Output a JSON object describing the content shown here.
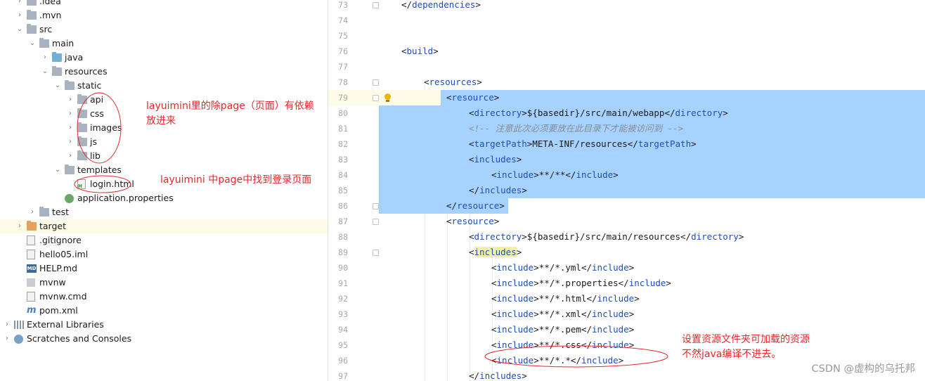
{
  "tree": [
    {
      "label": ".idea",
      "icon": "folder-icon",
      "depth": 1,
      "arrow": "›"
    },
    {
      "label": ".mvn",
      "icon": "folder-icon",
      "depth": 1,
      "arrow": "›"
    },
    {
      "label": "src",
      "icon": "folder-icon",
      "depth": 1,
      "arrow": "⌄"
    },
    {
      "label": "main",
      "icon": "folder-icon",
      "depth": 2,
      "arrow": "⌄"
    },
    {
      "label": "java",
      "icon": "folder-blue-icon",
      "depth": 3,
      "arrow": "›"
    },
    {
      "label": "resources",
      "icon": "folder-resources-icon",
      "depth": 3,
      "arrow": "⌄"
    },
    {
      "label": "static",
      "icon": "folder-icon",
      "depth": 4,
      "arrow": "⌄"
    },
    {
      "label": "api",
      "icon": "folder-icon",
      "depth": 5,
      "arrow": "›"
    },
    {
      "label": "css",
      "icon": "folder-icon",
      "depth": 5,
      "arrow": "›"
    },
    {
      "label": "images",
      "icon": "folder-icon",
      "depth": 5,
      "arrow": "›"
    },
    {
      "label": "js",
      "icon": "folder-icon",
      "depth": 5,
      "arrow": "›"
    },
    {
      "label": "lib",
      "icon": "folder-icon",
      "depth": 5,
      "arrow": "›"
    },
    {
      "label": "templates",
      "icon": "folder-icon",
      "depth": 4,
      "arrow": "⌄"
    },
    {
      "label": "login.html",
      "icon": "html-file-icon",
      "depth": 5,
      "arrow": ""
    },
    {
      "label": "application.properties",
      "icon": "properties-file-icon",
      "depth": 4,
      "arrow": ""
    },
    {
      "label": "test",
      "icon": "folder-icon",
      "depth": 2,
      "arrow": "›"
    },
    {
      "label": "target",
      "icon": "folder-orange-icon",
      "depth": 1,
      "arrow": "›",
      "selected": true
    },
    {
      "label": ".gitignore",
      "icon": "file-icon",
      "depth": 1,
      "arrow": ""
    },
    {
      "label": "hello05.iml",
      "icon": "iml-file-icon",
      "depth": 1,
      "arrow": ""
    },
    {
      "label": "HELP.md",
      "icon": "md-file-icon",
      "depth": 1,
      "arrow": ""
    },
    {
      "label": "mvnw",
      "icon": "mvnw-file-icon",
      "depth": 1,
      "arrow": ""
    },
    {
      "label": "mvnw.cmd",
      "icon": "file-icon",
      "depth": 1,
      "arrow": ""
    },
    {
      "label": "pom.xml",
      "icon": "maven-icon",
      "depth": 1,
      "arrow": ""
    },
    {
      "label": "External Libraries",
      "icon": "libraries-icon",
      "depth": 0,
      "arrow": "›"
    },
    {
      "label": "Scratches and Consoles",
      "icon": "scratches-icon",
      "depth": 0,
      "arrow": "›"
    }
  ],
  "annotations": {
    "static_note_line1": "layuimini里的除page（页面）有依赖",
    "static_note_line2": "放进来",
    "templates_note": "layuimini 中page中找到登录页面",
    "editor_note_line1": "设置资源文件夹可加载的资源",
    "editor_note_line2": "不然java编译不进去。",
    "color": "#e8282d"
  },
  "editor": {
    "lines": [
      {
        "num": "73",
        "indent": 0,
        "tokens": [
          [
            "t",
            "</"
          ],
          [
            "n",
            "dependencies"
          ],
          [
            "t",
            ">"
          ]
        ]
      },
      {
        "num": "74",
        "indent": 0,
        "tokens": []
      },
      {
        "num": "75",
        "indent": 0,
        "tokens": []
      },
      {
        "num": "76",
        "indent": 0,
        "tokens": [
          [
            "t",
            "<"
          ],
          [
            "n",
            "build"
          ],
          [
            "t",
            ">"
          ]
        ]
      },
      {
        "num": "77",
        "indent": 0,
        "tokens": []
      },
      {
        "num": "78",
        "indent": 1,
        "tokens": [
          [
            "t",
            "<"
          ],
          [
            "n",
            "resources"
          ],
          [
            "t",
            ">"
          ]
        ]
      },
      {
        "num": "79",
        "indent": 2,
        "tokens": [
          [
            "t",
            "<"
          ],
          [
            "n",
            "resource"
          ],
          [
            "t",
            ">"
          ]
        ],
        "caret": true,
        "bulb": true
      },
      {
        "num": "80",
        "indent": 3,
        "tokens": [
          [
            "t",
            "<"
          ],
          [
            "n",
            "directory"
          ],
          [
            "t",
            ">${basedir}/src/main/webapp</"
          ],
          [
            "n",
            "directory"
          ],
          [
            "t",
            ">"
          ]
        ]
      },
      {
        "num": "81",
        "indent": 3,
        "tokens": [
          [
            "c",
            "<!-- 注意此次必须要放在此目录下才能被访问到 -->"
          ]
        ]
      },
      {
        "num": "82",
        "indent": 3,
        "tokens": [
          [
            "t",
            "<"
          ],
          [
            "n",
            "targetPath"
          ],
          [
            "t",
            ">META-INF/resources</"
          ],
          [
            "n",
            "targetPath"
          ],
          [
            "t",
            ">"
          ]
        ]
      },
      {
        "num": "83",
        "indent": 3,
        "tokens": [
          [
            "t",
            "<"
          ],
          [
            "n",
            "includes"
          ],
          [
            "t",
            ">"
          ]
        ]
      },
      {
        "num": "84",
        "indent": 4,
        "tokens": [
          [
            "t",
            "<"
          ],
          [
            "n",
            "include"
          ],
          [
            "t",
            ">**/**</"
          ],
          [
            "n",
            "include"
          ],
          [
            "t",
            ">"
          ]
        ]
      },
      {
        "num": "85",
        "indent": 3,
        "tokens": [
          [
            "t",
            "</"
          ],
          [
            "n",
            "includes"
          ],
          [
            "t",
            ">"
          ]
        ]
      },
      {
        "num": "86",
        "indent": 2,
        "tokens": [
          [
            "t",
            "</"
          ],
          [
            "n",
            "resource"
          ],
          [
            "t",
            ">"
          ]
        ]
      },
      {
        "num": "87",
        "indent": 2,
        "tokens": [
          [
            "t",
            "<"
          ],
          [
            "n",
            "resource"
          ],
          [
            "t",
            ">"
          ]
        ]
      },
      {
        "num": "88",
        "indent": 3,
        "tokens": [
          [
            "t",
            "<"
          ],
          [
            "n",
            "directory"
          ],
          [
            "t",
            ">${basedir}/src/main/resources</"
          ],
          [
            "n",
            "directory"
          ],
          [
            "t",
            ">"
          ]
        ]
      },
      {
        "num": "89",
        "indent": 3,
        "tokens": [
          [
            "t",
            "<"
          ],
          [
            "h",
            "includes"
          ],
          [
            "t",
            ">"
          ]
        ]
      },
      {
        "num": "90",
        "indent": 4,
        "tokens": [
          [
            "t",
            "<"
          ],
          [
            "n",
            "include"
          ],
          [
            "t",
            ">**/*.yml</"
          ],
          [
            "n",
            "include"
          ],
          [
            "t",
            ">"
          ]
        ]
      },
      {
        "num": "91",
        "indent": 4,
        "tokens": [
          [
            "t",
            "<"
          ],
          [
            "n",
            "include"
          ],
          [
            "t",
            ">**/*.properties</"
          ],
          [
            "n",
            "include"
          ],
          [
            "t",
            ">"
          ]
        ]
      },
      {
        "num": "92",
        "indent": 4,
        "tokens": [
          [
            "t",
            "<"
          ],
          [
            "n",
            "include"
          ],
          [
            "t",
            ">**/*.html</"
          ],
          [
            "n",
            "include"
          ],
          [
            "t",
            ">"
          ]
        ]
      },
      {
        "num": "93",
        "indent": 4,
        "tokens": [
          [
            "t",
            "<"
          ],
          [
            "n",
            "include"
          ],
          [
            "t",
            ">**/*.xml</"
          ],
          [
            "n",
            "include"
          ],
          [
            "t",
            ">"
          ]
        ]
      },
      {
        "num": "94",
        "indent": 4,
        "tokens": [
          [
            "t",
            "<"
          ],
          [
            "n",
            "include"
          ],
          [
            "t",
            ">**/*.pem</"
          ],
          [
            "n",
            "include"
          ],
          [
            "t",
            ">"
          ]
        ]
      },
      {
        "num": "95",
        "indent": 4,
        "tokens": [
          [
            "t",
            "<"
          ],
          [
            "n",
            "include"
          ],
          [
            "t",
            ">**/*.css</"
          ],
          [
            "n",
            "include"
          ],
          [
            "t",
            ">"
          ]
        ]
      },
      {
        "num": "96",
        "indent": 4,
        "tokens": [
          [
            "t",
            "<"
          ],
          [
            "n",
            "include"
          ],
          [
            "t",
            ">**/*.*</"
          ],
          [
            "n",
            "include"
          ],
          [
            "t",
            ">"
          ]
        ]
      },
      {
        "num": "97",
        "indent": 3,
        "tokens": [
          [
            "t",
            "</"
          ],
          [
            "n",
            "includes"
          ],
          [
            "t",
            ">"
          ]
        ]
      }
    ],
    "selection_first": "79",
    "selection_last": "86"
  },
  "colors": {
    "tag_name": "#1d4fb6",
    "text": "#1a1a1a",
    "comment": "#8c8c8c",
    "selection": "#a6d2ff",
    "highlight_bg": "#f2f2a0"
  },
  "watermark": "CSDN @虚构的乌托邦"
}
